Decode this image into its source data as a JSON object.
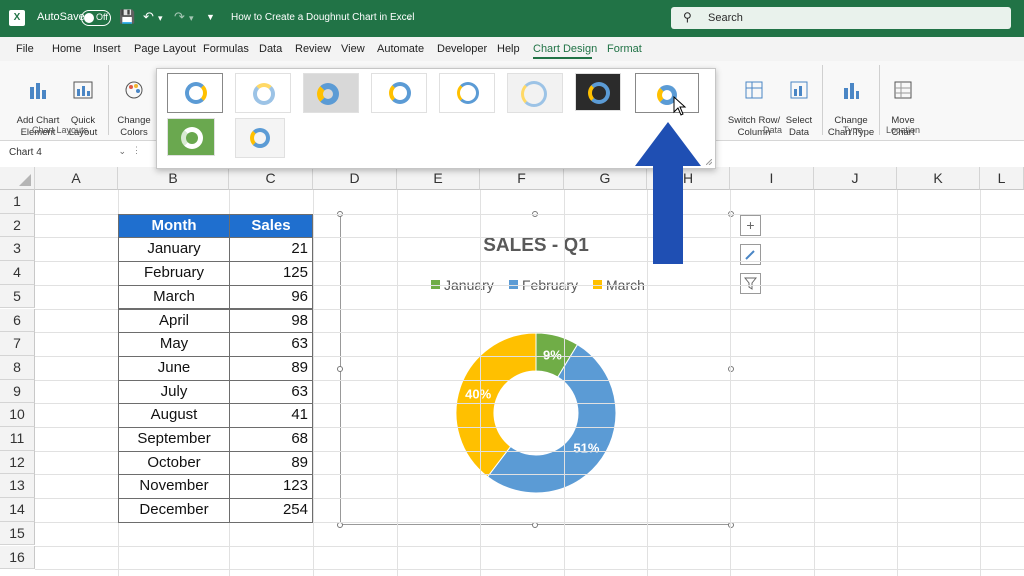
{
  "titlebar": {
    "app_icon": "excel-icon",
    "autosave_label": "AutoSave",
    "autosave_state": "Off",
    "document_title": "How to Create a Doughnut Chart in Excel",
    "search_placeholder": "Search"
  },
  "tabs": [
    "File",
    "Home",
    "Insert",
    "Page Layout",
    "Formulas",
    "Data",
    "Review",
    "View",
    "Automate",
    "Developer",
    "Help",
    "Chart Design",
    "Format"
  ],
  "active_tab": "Chart Design",
  "ribbon": {
    "add_chart_element": "Add Chart\nElement",
    "quick_layout": "Quick\nLayout",
    "chart_layouts_group": "Chart Layouts",
    "change_colors": "Change\nColors",
    "switch_row_column": "Switch Row/\nColumn",
    "select_data": "Select\nData",
    "data_group": "Data",
    "change_chart_type": "Change\nChart Type",
    "type_group": "Type",
    "move_chart": "Move\nChart",
    "location_group": "Location"
  },
  "name_box": "Chart 4",
  "columns": [
    "A",
    "B",
    "C",
    "D",
    "E",
    "F",
    "G",
    "H",
    "I",
    "J",
    "K",
    "L"
  ],
  "rows": [
    "1",
    "2",
    "3",
    "4",
    "5",
    "6",
    "7",
    "8",
    "9",
    "10",
    "11",
    "12",
    "13",
    "14",
    "15",
    "16"
  ],
  "table": {
    "headers": [
      "Month",
      "Sales"
    ],
    "rows": [
      [
        "January",
        "21"
      ],
      [
        "February",
        "125"
      ],
      [
        "March",
        "96"
      ],
      [
        "April",
        "98"
      ],
      [
        "May",
        "63"
      ],
      [
        "June",
        "89"
      ],
      [
        "July",
        "63"
      ],
      [
        "August",
        "41"
      ],
      [
        "September",
        "68"
      ],
      [
        "October",
        "89"
      ],
      [
        "November",
        "123"
      ],
      [
        "December",
        "254"
      ]
    ],
    "header_color": "#1f6fcf"
  },
  "chart_data": {
    "type": "pie",
    "variant": "doughnut",
    "title": "SALES - Q1",
    "legend_position": "top",
    "categories": [
      "January",
      "February",
      "March"
    ],
    "values": [
      21,
      125,
      96
    ],
    "data_labels": [
      "9%",
      "51%",
      "40%"
    ],
    "colors": [
      "#70ad47",
      "#5b9bd5",
      "#ffc000"
    ]
  }
}
